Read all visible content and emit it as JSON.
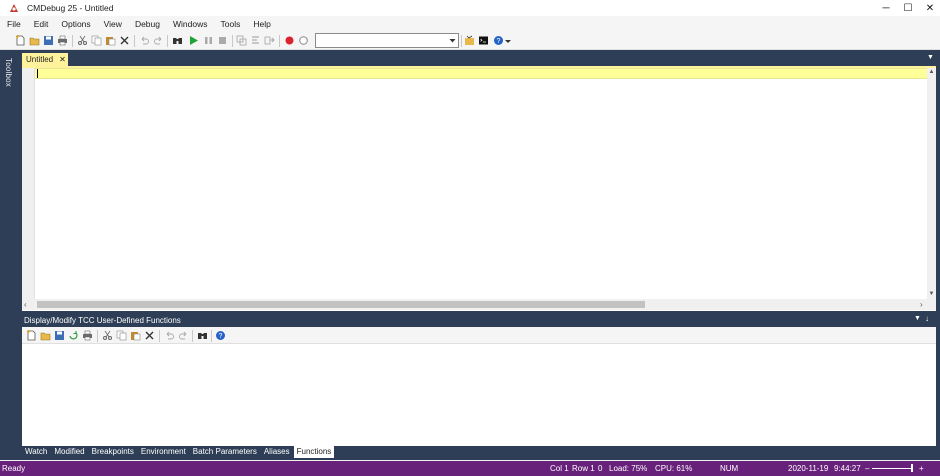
{
  "window": {
    "title": "CMDebug 25 - Untitled",
    "minimize_glyph": "─",
    "maximize_glyph": "☐",
    "close_glyph": "✕"
  },
  "menu": [
    "File",
    "Edit",
    "Options",
    "View",
    "Debug",
    "Windows",
    "Tools",
    "Help"
  ],
  "toolbar": {
    "icons": [
      "new-file-icon",
      "open-folder-icon",
      "save-icon",
      "print-icon",
      "cut-icon",
      "copy-icon",
      "paste-icon",
      "delete-icon",
      "undo-icon",
      "redo-icon",
      "find-icon",
      "run-icon",
      "pause-icon",
      "stop-icon",
      "step-into-icon",
      "step-over-icon",
      "step-out-icon",
      "breakpoint-icon",
      "clear-breakpoint-icon",
      "properties-icon",
      "console-icon",
      "help-icon"
    ],
    "combo_value": ""
  },
  "toolbox": {
    "label": "Toolbox"
  },
  "document": {
    "tab_label": "Untitled",
    "tab_close": "✕",
    "accent_color": "#fff29d"
  },
  "panel": {
    "title": "Display/Modify TCC User-Defined Functions",
    "pin_glyph": "↓",
    "arrow_glyph": "▼"
  },
  "bottom_tabs": [
    {
      "label": "Watch",
      "active": false
    },
    {
      "label": "Modified",
      "active": false
    },
    {
      "label": "Breakpoints",
      "active": false
    },
    {
      "label": "Environment",
      "active": false
    },
    {
      "label": "Batch Parameters",
      "active": false
    },
    {
      "label": "Aliases",
      "active": false
    },
    {
      "label": "Functions",
      "active": true
    }
  ],
  "status": {
    "ready": "Ready",
    "col": "Col 1",
    "row": "Row 1",
    "zero": "0",
    "load": "Load: 75%",
    "cpu": "CPU: 61%",
    "num": "NUM",
    "date": "2020-11-19",
    "time": "9:44:27",
    "zoom_minus": "–",
    "zoom_plus": "+",
    "bar_color": "#68217a"
  }
}
